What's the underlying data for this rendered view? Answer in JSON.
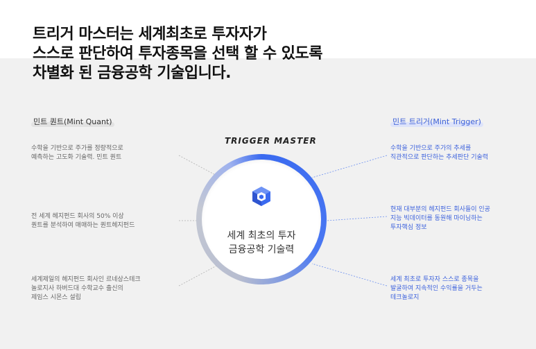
{
  "headline": [
    "트리거 마스터는 세계최초로 투자자가",
    "스스로 판단하여 투자종목을 선택 할 수 있도록",
    "차별화 된 금융공학 기술입니다."
  ],
  "left": {
    "title": "민트 퀀트(Mint Quant)",
    "items": [
      [
        "수학을 기반으로 주가를 정량적으로",
        "예측하는 고도화 기술력. 민트 퀀트"
      ],
      [
        "전 세계 헤지펀드 회사의 50% 이상",
        "퀀트를 분석하여 매매하는 퀀트헤지펀드"
      ],
      [
        "세계제일의 헤지펀드 회사인 르네상스테크",
        "놀로지사 하버드대 수학교수 출신의",
        "제임스 시몬스 설립"
      ]
    ]
  },
  "right": {
    "title": "민트 트리거(Mint Trigger)",
    "items": [
      [
        "수학을 기반으로 주가의 추세를",
        "직관적으로 판단하는 추세판단 기술력"
      ],
      [
        "현재 대부분의 헤지펀드 회사들이 인공",
        "지능 빅데이터를 동원해 마이닝하는",
        "투자핵심 정보"
      ],
      [
        "세계 최초로 투자자 스스로 종목을",
        "발굴하여 지속적인 수익률을 거두는",
        "테크놀로지"
      ]
    ]
  },
  "center": {
    "brand": "TRIGGER MASTER",
    "lines": [
      "세계 최초의 투자",
      "금융공학 기술력"
    ],
    "icon": "cube-logo-icon"
  },
  "colors": {
    "accent": "#3a6af0",
    "headline": "#111111",
    "muted": "#666666"
  }
}
